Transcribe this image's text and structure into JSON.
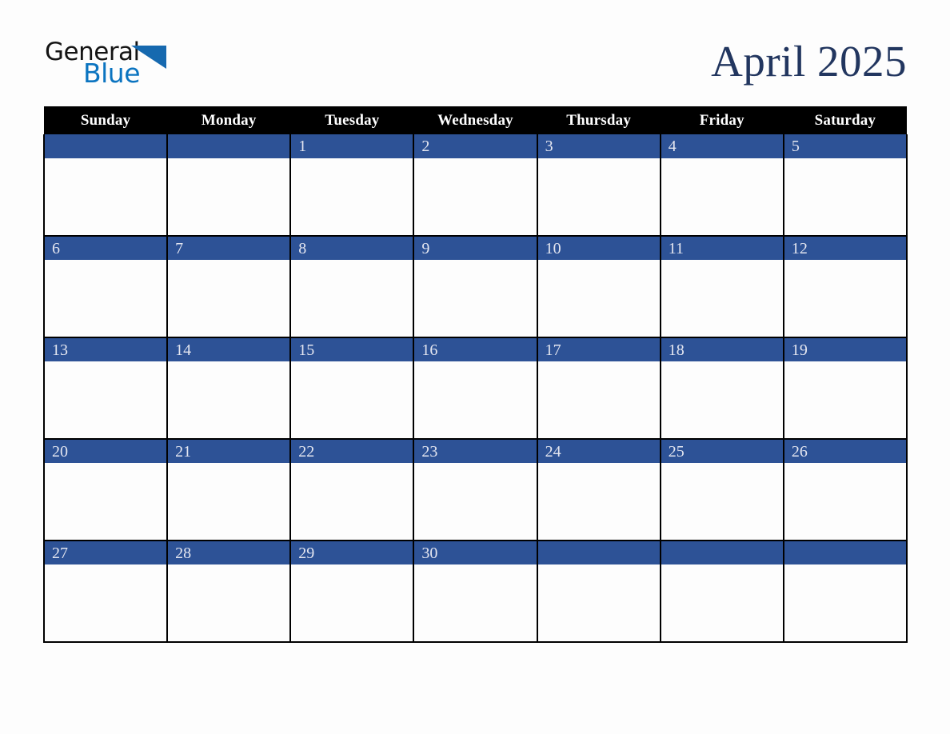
{
  "brand": {
    "name_part1": "General",
    "name_part2": "Blue",
    "mark_icon": "triangle-flag-icon",
    "color_dark": "#141414",
    "color_blue": "#0B74C0"
  },
  "header": {
    "title": "April 2025",
    "month": "April",
    "year": "2025",
    "title_color": "#22365F"
  },
  "calendar": {
    "weekdays": [
      "Sunday",
      "Monday",
      "Tuesday",
      "Wednesday",
      "Thursday",
      "Friday",
      "Saturday"
    ],
    "header_bg": "#000000",
    "header_fg": "#FFFFFF",
    "datebar_bg": "#2D5296",
    "datebar_fg": "#E4E6F0",
    "cell_bg": "#FDFDFD",
    "grid_color": "#000000",
    "weeks": [
      [
        "",
        "",
        "1",
        "2",
        "3",
        "4",
        "5"
      ],
      [
        "6",
        "7",
        "8",
        "9",
        "10",
        "11",
        "12"
      ],
      [
        "13",
        "14",
        "15",
        "16",
        "17",
        "18",
        "19"
      ],
      [
        "20",
        "21",
        "22",
        "23",
        "24",
        "25",
        "26"
      ],
      [
        "27",
        "28",
        "29",
        "30",
        "",
        "",
        ""
      ]
    ]
  },
  "page": {
    "background": "#FDFDFD"
  }
}
